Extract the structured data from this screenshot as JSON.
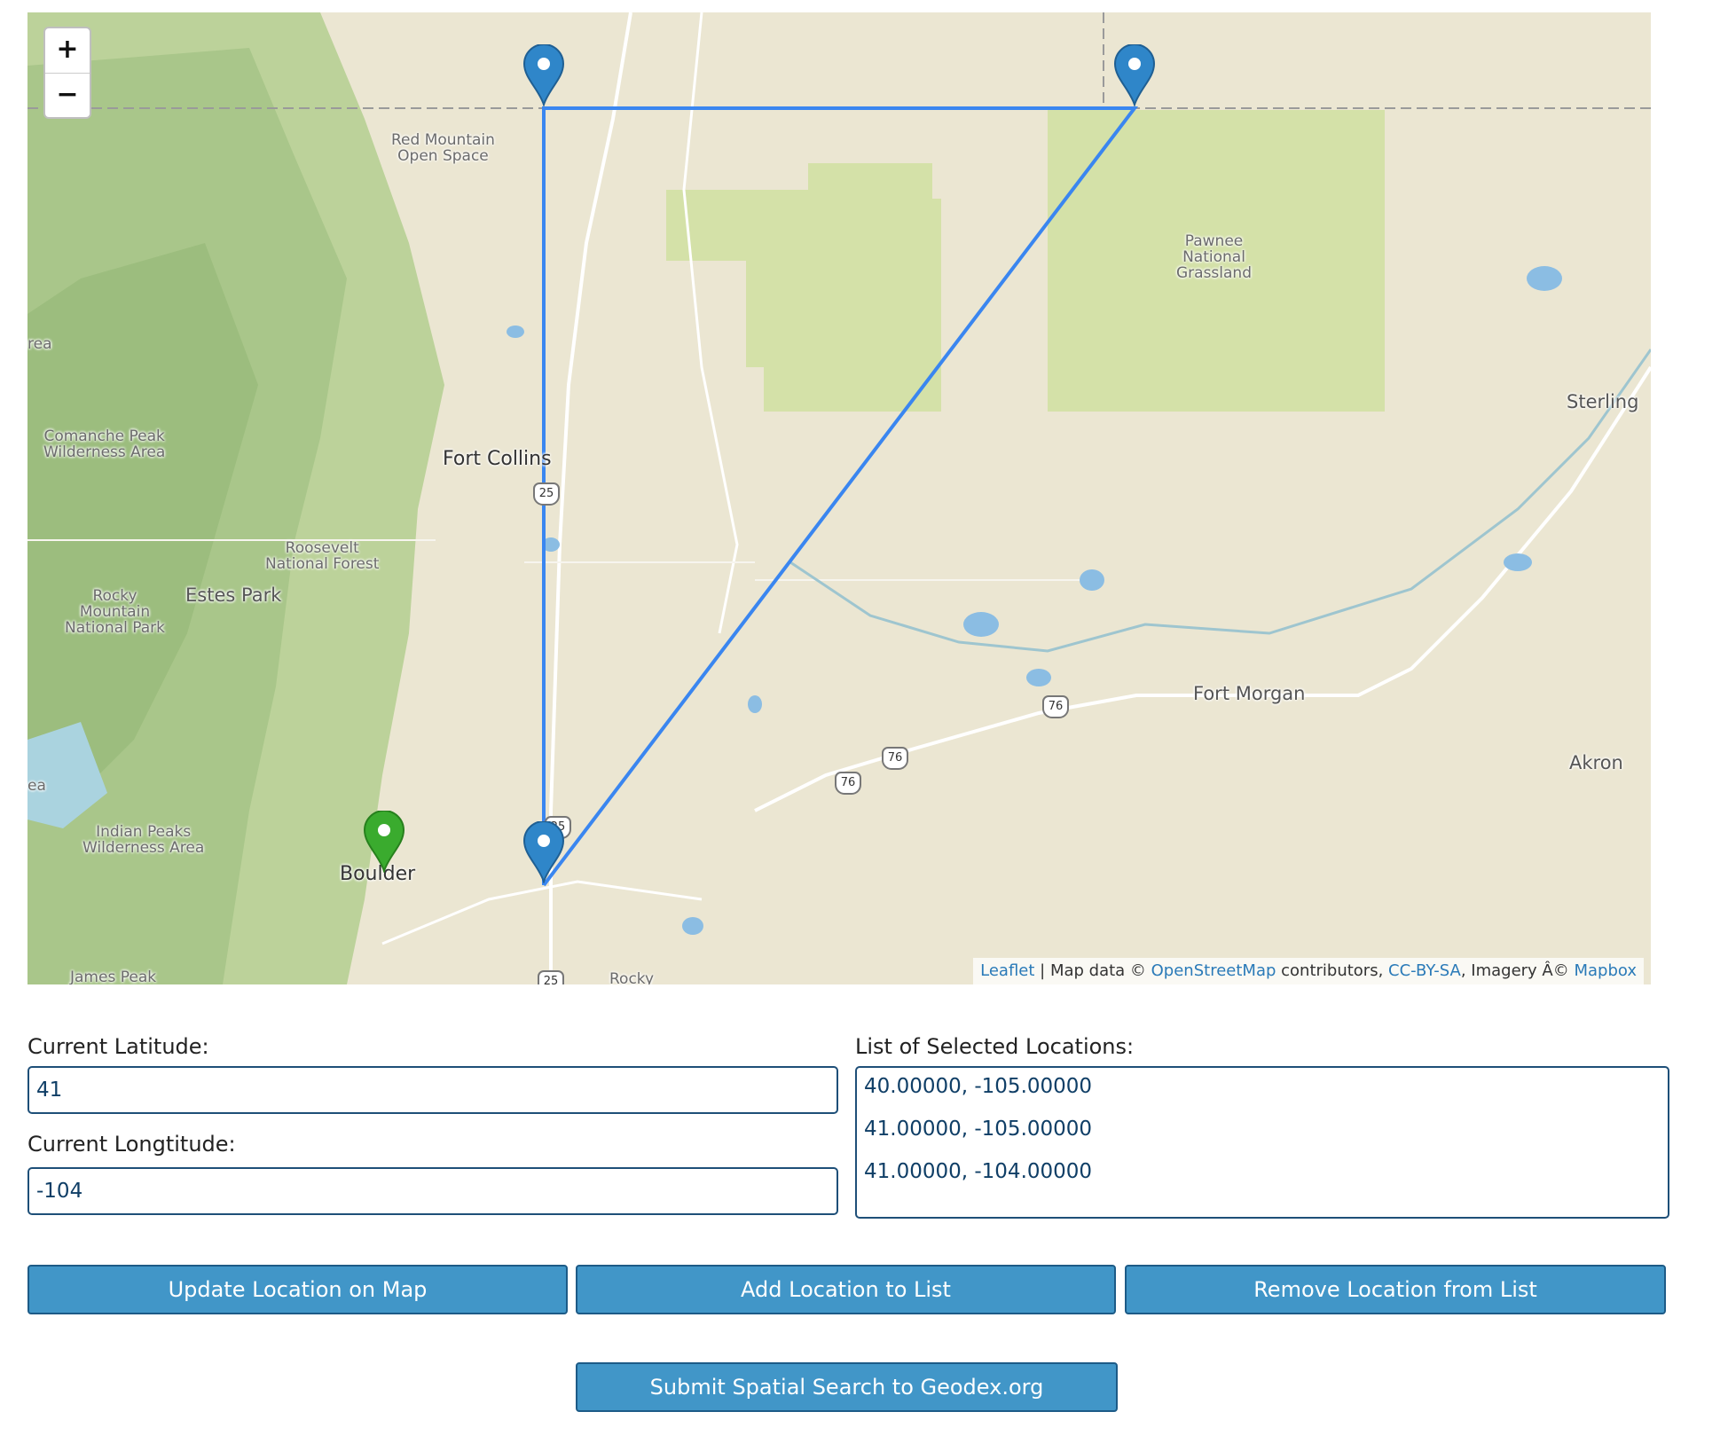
{
  "map": {
    "zoom_in": "+",
    "zoom_out": "−",
    "places": {
      "red_mountain": "Red Mountain\nOpen Space",
      "pawnee": "Pawnee\nNational\nGrassland",
      "area_left": "rea",
      "comanche": "Comanche Peak\nWilderness Area",
      "fort_collins": "Fort Collins",
      "sterling": "Sterling",
      "roosevelt": "Roosevelt\nNational Forest",
      "estes_park": "Estes Park",
      "rocky_mountain": "Rocky\nMountain\nNational Park",
      "fort_morgan": "Fort Morgan",
      "akron": "Akron",
      "ea_left": "ea",
      "indian_peaks": "Indian Peaks\nWilderness Area",
      "boulder": "Boulder",
      "james_peak": "James Peak",
      "rocky_bottom": "Rocky"
    },
    "shields": {
      "i25_a": "25",
      "i25_b": "25",
      "i25_c": "25",
      "i76_a": "76",
      "i76_b": "76",
      "i76_c": "76"
    },
    "attribution": {
      "leaflet": "Leaflet",
      "sep": " | Map data © ",
      "osm": "OpenStreetMap",
      "contrib": " contributors, ",
      "ccbysa": "CC-BY-SA",
      "imagery": ", Imagery Â© ",
      "mapbox": "Mapbox"
    },
    "colors": {
      "polygon": "#3a86f0",
      "marker_blue": "#2f86c9",
      "marker_green": "#3aab2e"
    }
  },
  "form": {
    "lat_label": "Current Latitude:",
    "lat_value": "41",
    "lon_label": "Current Longtitude:",
    "lon_value": "-104",
    "list_label": "List of Selected Locations:",
    "locations": [
      "40.00000, -105.00000",
      "41.00000, -105.00000",
      "41.00000, -104.00000"
    ]
  },
  "buttons": {
    "update": "Update Location on Map",
    "add": "Add Location to List",
    "remove": "Remove Location from List",
    "submit": "Submit Spatial Search to Geodex.org"
  }
}
